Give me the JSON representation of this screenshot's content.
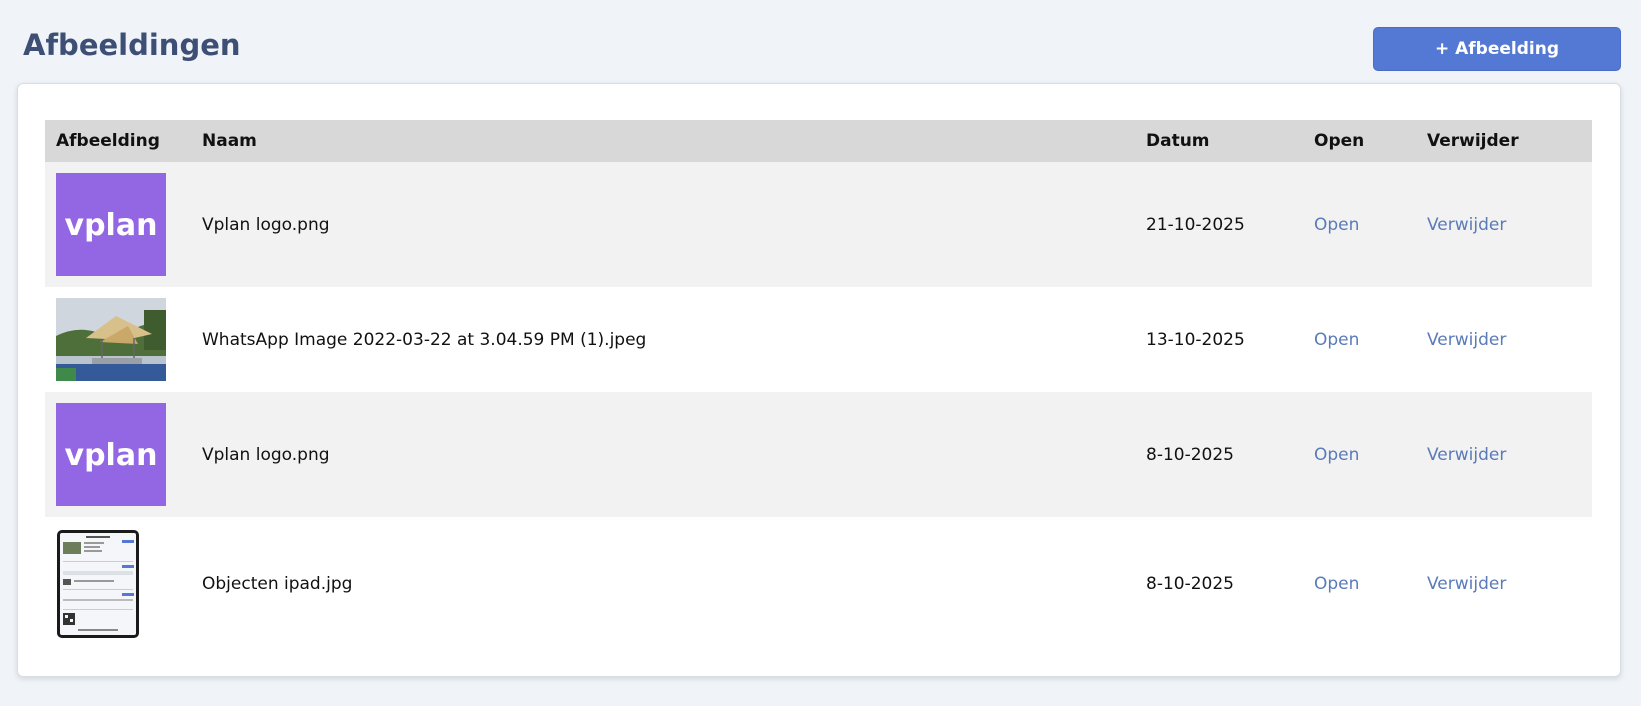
{
  "page": {
    "title": "Afbeeldingen",
    "add_button_label": "+ Afbeelding"
  },
  "table": {
    "columns": [
      "Afbeelding",
      "Naam",
      "Datum",
      "Open",
      "Verwijder"
    ],
    "rows": [
      {
        "thumbnail": "vplan-logo-thumbnail",
        "name": "Vplan logo.png",
        "date": "21-10-2025",
        "open": "Open",
        "delete": "Verwijder"
      },
      {
        "thumbnail": "whatsapp-photo-thumbnail",
        "name": "WhatsApp Image 2022-03-22 at 3.04.59 PM (1).jpeg",
        "date": "13-10-2025",
        "open": "Open",
        "delete": "Verwijder"
      },
      {
        "thumbnail": "vplan-logo-thumbnail",
        "name": "Vplan logo.png",
        "date": "8-10-2025",
        "open": "Open",
        "delete": "Verwijder"
      },
      {
        "thumbnail": "ipad-screenshot-thumbnail",
        "name": "Objecten ipad.jpg",
        "date": "8-10-2025",
        "open": "Open",
        "delete": "Verwijder"
      }
    ],
    "logo_text": "vplan"
  },
  "colors": {
    "title": "#3d4f75",
    "accent_button": "#5479d4",
    "link": "#5a7ab8",
    "header_bg": "#d8d8d8",
    "row_shade": "#f2f2f2",
    "logo_bg": "#9366e4"
  }
}
